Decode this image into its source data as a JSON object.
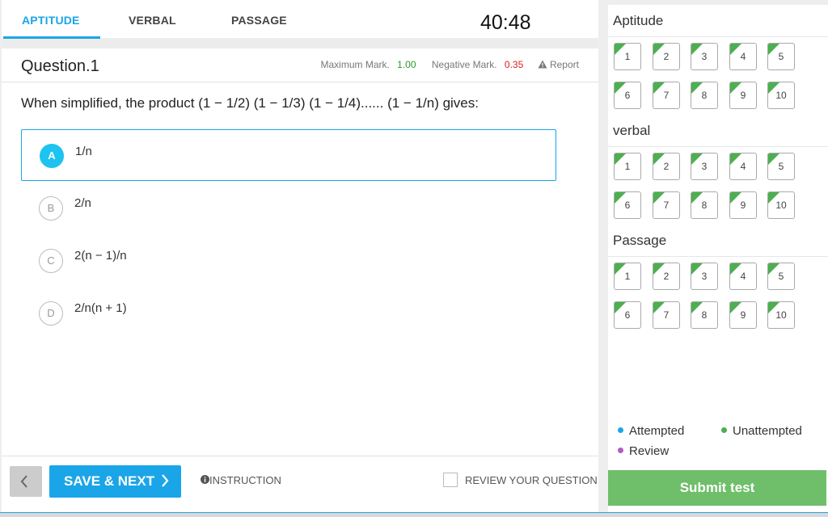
{
  "tabs": [
    {
      "label": "APTITUDE",
      "active": true
    },
    {
      "label": "VERBAL",
      "active": false
    },
    {
      "label": "PASSAGE",
      "active": false
    }
  ],
  "timer": "40:48",
  "question": {
    "title": "Question.1",
    "max_mark_label": "Maximum Mark.",
    "max_mark_value": "1.00",
    "neg_mark_label": "Negative Mark.",
    "neg_mark_value": "0.35",
    "report_label": "Report",
    "text": "When simplified, the product (1 − 1/2) (1 − 1/3) (1 − 1/4)...... (1 − 1/n) gives:",
    "options": [
      {
        "letter": "A",
        "text": "1/n",
        "selected": true
      },
      {
        "letter": "B",
        "text": "2/n",
        "selected": false
      },
      {
        "letter": "C",
        "text": "2(n − 1)/n",
        "selected": false
      },
      {
        "letter": "D",
        "text": "2/n(n + 1)",
        "selected": false
      }
    ]
  },
  "footer": {
    "save_label": "SAVE & NEXT",
    "instruction_label": "INSTRUCTION",
    "review_label": "REVIEW YOUR QUESTION"
  },
  "palette": {
    "sections": [
      {
        "title": "Aptitude",
        "numbers": [
          "1",
          "2",
          "3",
          "4",
          "5",
          "6",
          "7",
          "8",
          "9",
          "10"
        ]
      },
      {
        "title": "verbal",
        "numbers": [
          "1",
          "2",
          "3",
          "4",
          "5",
          "6",
          "7",
          "8",
          "9",
          "10"
        ]
      },
      {
        "title": "Passage",
        "numbers": [
          "1",
          "2",
          "3",
          "4",
          "5",
          "6",
          "7",
          "8",
          "9",
          "10"
        ]
      }
    ],
    "legend": {
      "attempted": "Attempted",
      "unattempted": "Unattempted",
      "review": "Review"
    },
    "submit_label": "Submit test"
  },
  "colors": {
    "accent": "#1aa5e8",
    "attempted": "#1aa5e8",
    "unattempted": "#4caf50",
    "review": "#b05cc6",
    "submit": "#6fbe6a"
  }
}
